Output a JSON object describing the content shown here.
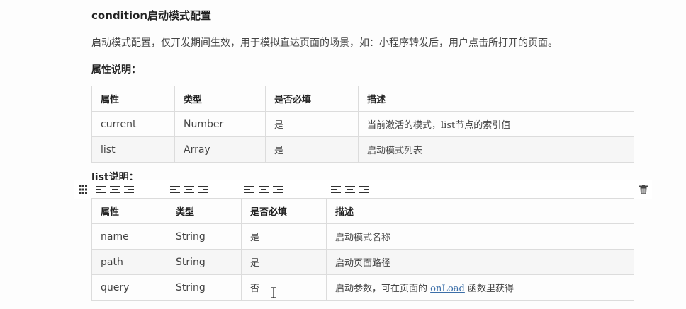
{
  "heading": "condition启动模式配置",
  "description": "启动模式配置，仅开发期间生效，用于模拟直达页面的场景，如：小程序转发后，用户点击所打开的页面。",
  "attr_title": "属性说明：",
  "condition_table": {
    "headers": [
      "属性",
      "类型",
      "是否必填",
      "描述"
    ],
    "rows": [
      {
        "attr": "current",
        "type": "Number",
        "required": "是",
        "desc": "当前激活的模式，list节点的索引值"
      },
      {
        "attr": "list",
        "type": "Array",
        "required": "是",
        "desc": "启动模式列表"
      }
    ]
  },
  "list_heading": "list说明：",
  "toolbar": {
    "icons": [
      "grid-icon",
      "align-left-icon",
      "align-center-icon",
      "align-right-icon",
      "trash-icon"
    ]
  },
  "list_table": {
    "headers": [
      "属性",
      "类型",
      "是否必填",
      "描述"
    ],
    "rows": [
      {
        "attr": "name",
        "type": "String",
        "required": "是",
        "desc": "启动模式名称"
      },
      {
        "attr": "path",
        "type": "String",
        "required": "是",
        "desc": "启动页面路径"
      },
      {
        "attr": "query",
        "type": "String",
        "required": "否",
        "desc_pre": "启动参数，可在页面的 ",
        "desc_link": "onLoad",
        "desc_post": " 函数里获得"
      }
    ]
  }
}
